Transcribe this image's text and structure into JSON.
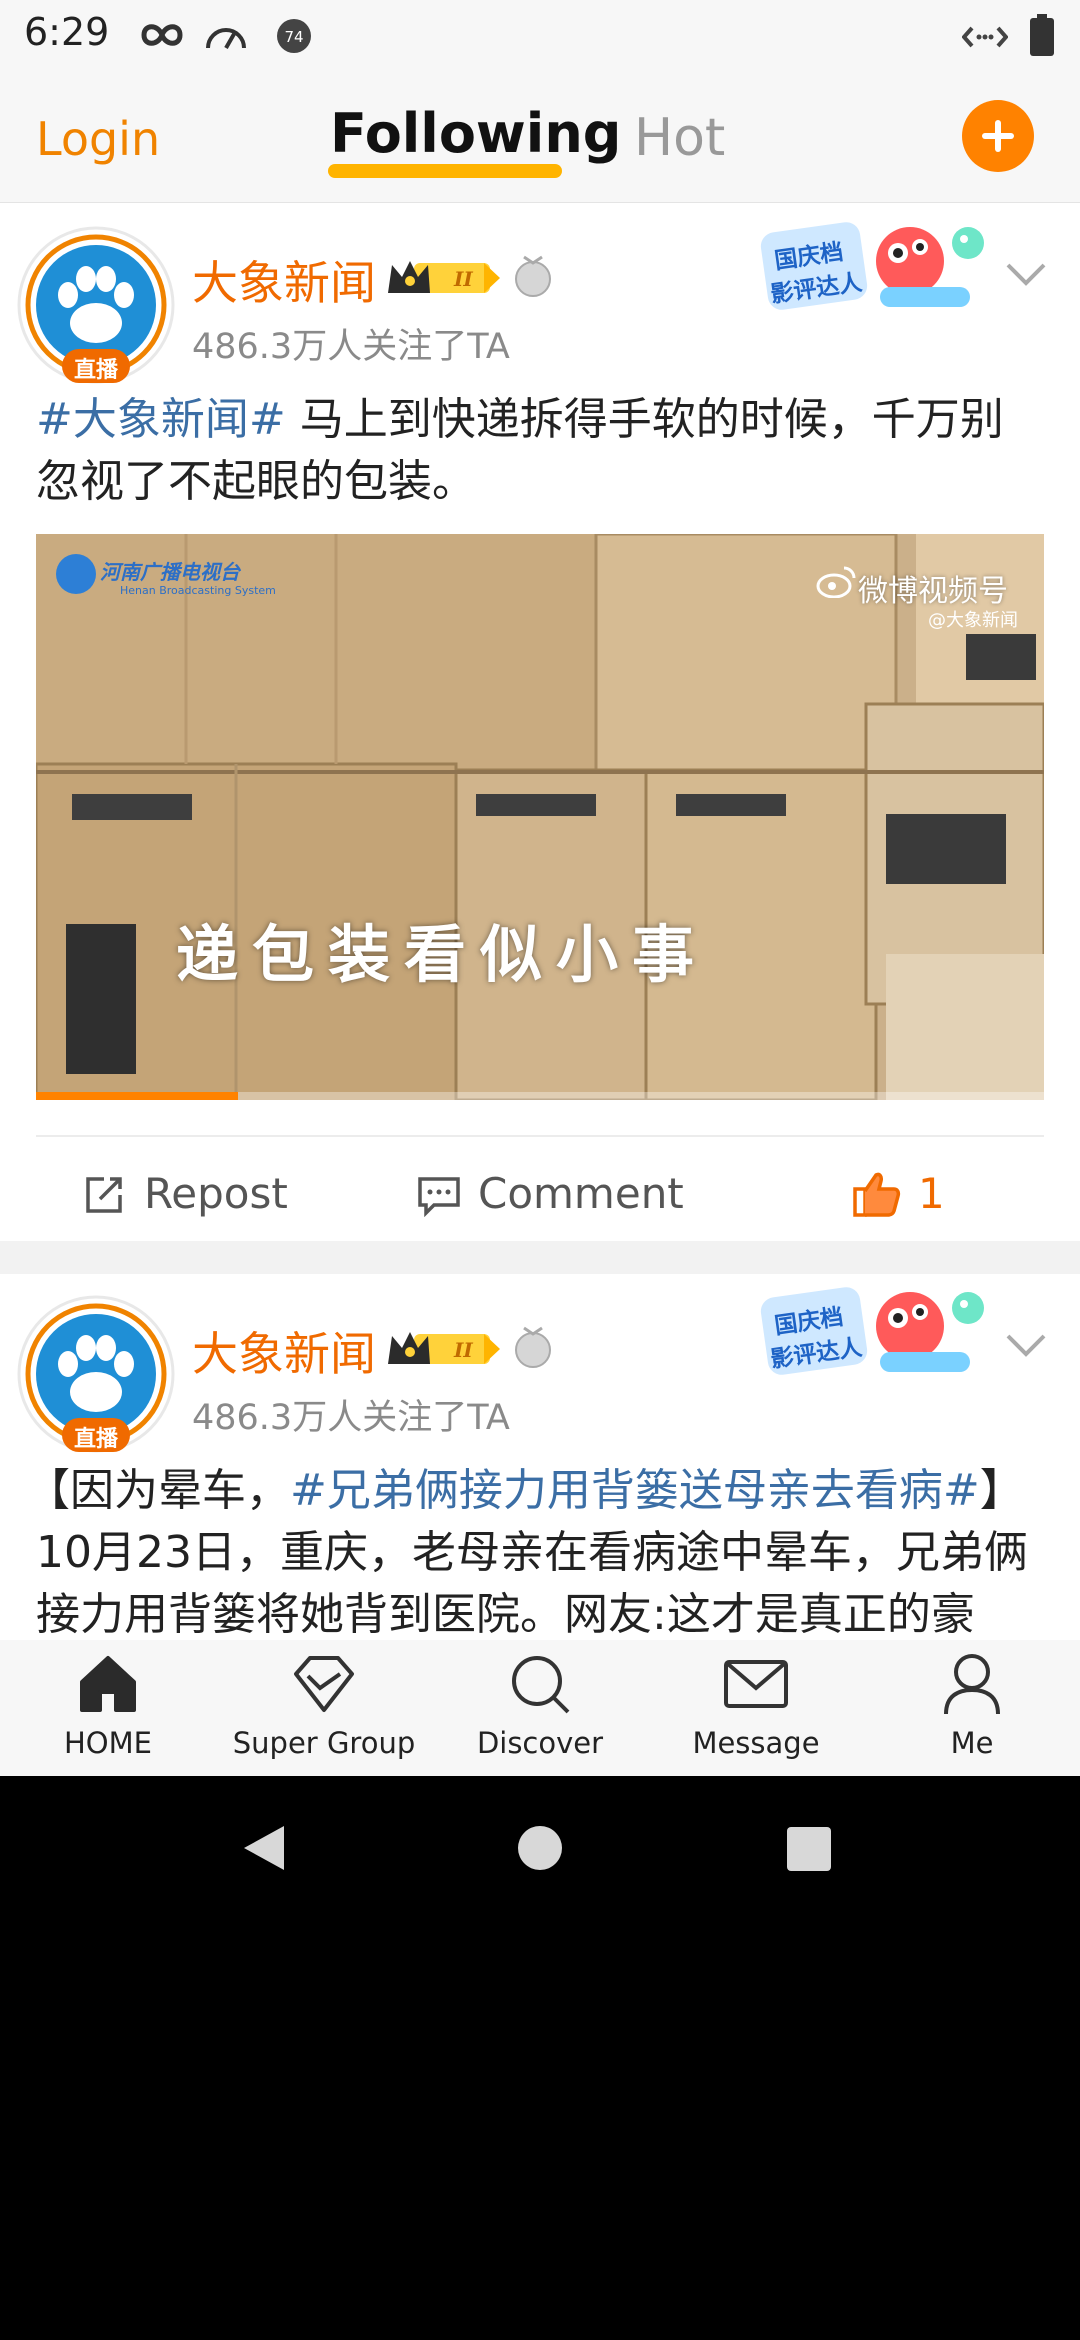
{
  "status_bar": {
    "time": "6:29",
    "icons": [
      "infinity-icon",
      "speedometer-icon",
      "notification-74-icon",
      "data-arrows-icon",
      "battery-icon"
    ],
    "notification_count": "74"
  },
  "top_nav": {
    "login_label": "Login",
    "tabs": [
      {
        "label": "Following",
        "active": true
      },
      {
        "label": "Hot",
        "active": false
      }
    ],
    "accent": "#ff8200"
  },
  "posts": [
    {
      "username": "大象新闻",
      "live_badge": "直播",
      "followers": "486.3万人关注了TA",
      "text_hashtag": "#大象新闻#",
      "text_body": " 马上到快递拆得手软的时候，千万别忽视了不起眼的包装。",
      "badge_text_top": "国庆档",
      "badge_text_bottom": "影评达人",
      "video": {
        "caption": "递包装看似小事",
        "watermark": "微博视频号",
        "watermark_sub": "@大象新闻",
        "channel_logo": "河南广播电视台",
        "channel_logo_sub": "Henan Broadcasting System",
        "progress": 0.2
      },
      "actions": {
        "repost": "Repost",
        "comment": "Comment",
        "likes": "1"
      }
    },
    {
      "username": "大象新闻",
      "live_badge": "直播",
      "followers": "486.3万人关注了TA",
      "text_pre": "【因为晕车，",
      "text_hashtag": "#兄弟俩接力用背篓送母亲去看病#",
      "text_post": "】",
      "text_line2": "10月23日，重庆，老母亲在看病途中晕车，兄弟俩",
      "text_line3": "接力用背篓将她背到医院。网友:这才是真正的豪",
      "badge_text_top": "国庆档",
      "badge_text_bottom": "影评达人"
    }
  ],
  "tab_bar": [
    {
      "label": "HOME",
      "icon": "home-icon"
    },
    {
      "label": "Super Group",
      "icon": "diamond-icon"
    },
    {
      "label": "Discover",
      "icon": "search-icon"
    },
    {
      "label": "Message",
      "icon": "envelope-icon"
    },
    {
      "label": "Me",
      "icon": "person-icon"
    }
  ]
}
